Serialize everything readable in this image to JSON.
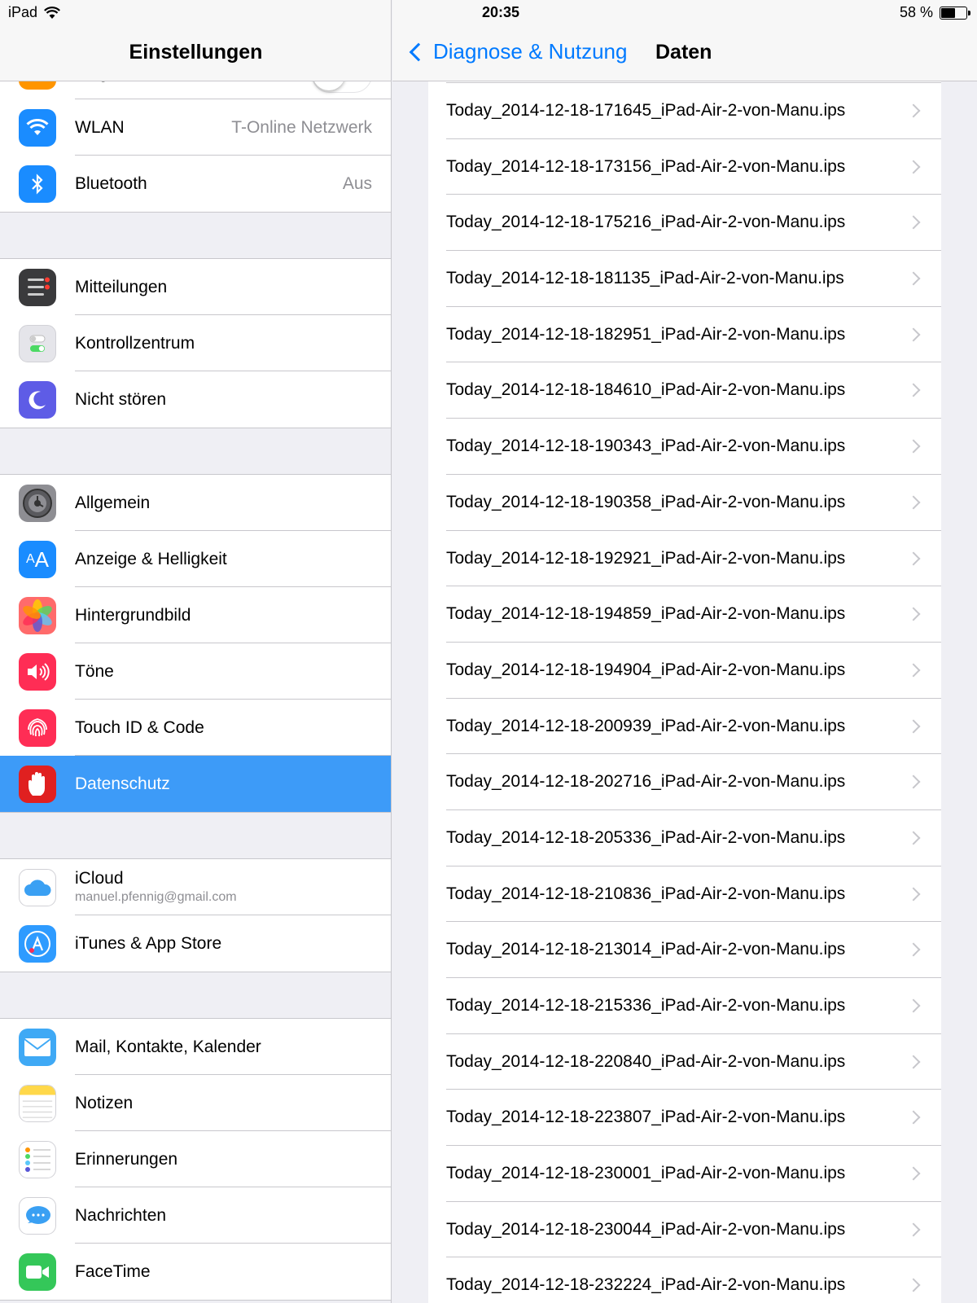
{
  "status_bar": {
    "device": "iPad",
    "time": "20:35",
    "battery_text": "58 %",
    "battery_level": 0.58
  },
  "sidebar": {
    "title": "Einstellungen",
    "groups": [
      {
        "items": [
          {
            "label": "Flugmodus",
            "icon": "airplane-icon",
            "color": "#ff9500",
            "partial": true,
            "toggle": false
          },
          {
            "label": "WLAN",
            "value": "T-Online Netzwerk",
            "icon": "wifi-icon",
            "color": "#1a8cff"
          },
          {
            "label": "Bluetooth",
            "value": "Aus",
            "icon": "bluetooth-icon",
            "color": "#1a8cff"
          }
        ]
      },
      {
        "items": [
          {
            "label": "Mitteilungen",
            "icon": "notifications-icon",
            "color": "#3a3a3c"
          },
          {
            "label": "Kontrollzentrum",
            "icon": "control-center-icon",
            "color": "#e5e5ea"
          },
          {
            "label": "Nicht stören",
            "icon": "moon-icon",
            "color": "#5e5ce6"
          }
        ]
      },
      {
        "items": [
          {
            "label": "Allgemein",
            "icon": "gear-icon",
            "color": "#8e8e93"
          },
          {
            "label": "Anzeige & Helligkeit",
            "icon": "display-aa-icon",
            "color": "#1a8cff"
          },
          {
            "label": "Hintergrundbild",
            "icon": "wallpaper-flower-icon",
            "color": "#ff6b6b"
          },
          {
            "label": "Töne",
            "icon": "speaker-icon",
            "color": "#ff2d55"
          },
          {
            "label": "Touch ID & Code",
            "icon": "fingerprint-icon",
            "color": "#ff2d55"
          },
          {
            "label": "Datenschutz",
            "icon": "hand-icon",
            "color": "#e02020",
            "selected": true
          }
        ]
      },
      {
        "items": [
          {
            "label": "iCloud",
            "sublabel": "manuel.pfennig@gmail.com",
            "icon": "cloud-icon",
            "color": "#ffffff"
          },
          {
            "label": "iTunes & App Store",
            "icon": "app-store-icon",
            "color": "#2e9bff"
          }
        ]
      },
      {
        "items": [
          {
            "label": "Mail, Kontakte, Kalender",
            "icon": "mail-icon",
            "color": "#3fa9f5"
          },
          {
            "label": "Notizen",
            "icon": "notes-icon",
            "color": "#ffffff"
          },
          {
            "label": "Erinnerungen",
            "icon": "reminders-icon",
            "color": "#ffffff"
          },
          {
            "label": "Nachrichten",
            "icon": "messages-icon",
            "color": "#ffffff"
          },
          {
            "label": "FaceTime",
            "icon": "facetime-icon",
            "color": "#34c759"
          }
        ]
      }
    ]
  },
  "detail": {
    "back_label": "Diagnose & Nutzung",
    "title": "Daten",
    "files": [
      "Today_2014-12-18-171645_iPad-Air-2-von-Manu.ips",
      "Today_2014-12-18-173156_iPad-Air-2-von-Manu.ips",
      "Today_2014-12-18-175216_iPad-Air-2-von-Manu.ips",
      "Today_2014-12-18-181135_iPad-Air-2-von-Manu.ips",
      "Today_2014-12-18-182951_iPad-Air-2-von-Manu.ips",
      "Today_2014-12-18-184610_iPad-Air-2-von-Manu.ips",
      "Today_2014-12-18-190343_iPad-Air-2-von-Manu.ips",
      "Today_2014-12-18-190358_iPad-Air-2-von-Manu.ips",
      "Today_2014-12-18-192921_iPad-Air-2-von-Manu.ips",
      "Today_2014-12-18-194859_iPad-Air-2-von-Manu.ips",
      "Today_2014-12-18-194904_iPad-Air-2-von-Manu.ips",
      "Today_2014-12-18-200939_iPad-Air-2-von-Manu.ips",
      "Today_2014-12-18-202716_iPad-Air-2-von-Manu.ips",
      "Today_2014-12-18-205336_iPad-Air-2-von-Manu.ips",
      "Today_2014-12-18-210836_iPad-Air-2-von-Manu.ips",
      "Today_2014-12-18-213014_iPad-Air-2-von-Manu.ips",
      "Today_2014-12-18-215336_iPad-Air-2-von-Manu.ips",
      "Today_2014-12-18-220840_iPad-Air-2-von-Manu.ips",
      "Today_2014-12-18-223807_iPad-Air-2-von-Manu.ips",
      "Today_2014-12-18-230001_iPad-Air-2-von-Manu.ips",
      "Today_2014-12-18-230044_iPad-Air-2-von-Manu.ips",
      "Today_2014-12-18-232224_iPad-Air-2-von-Manu.ips"
    ]
  },
  "colors": {
    "accent": "#007aff",
    "selection": "#3d9bf8",
    "separator": "#c8c7cc",
    "background": "#efeff4",
    "secondary_text": "#8e8e93"
  }
}
